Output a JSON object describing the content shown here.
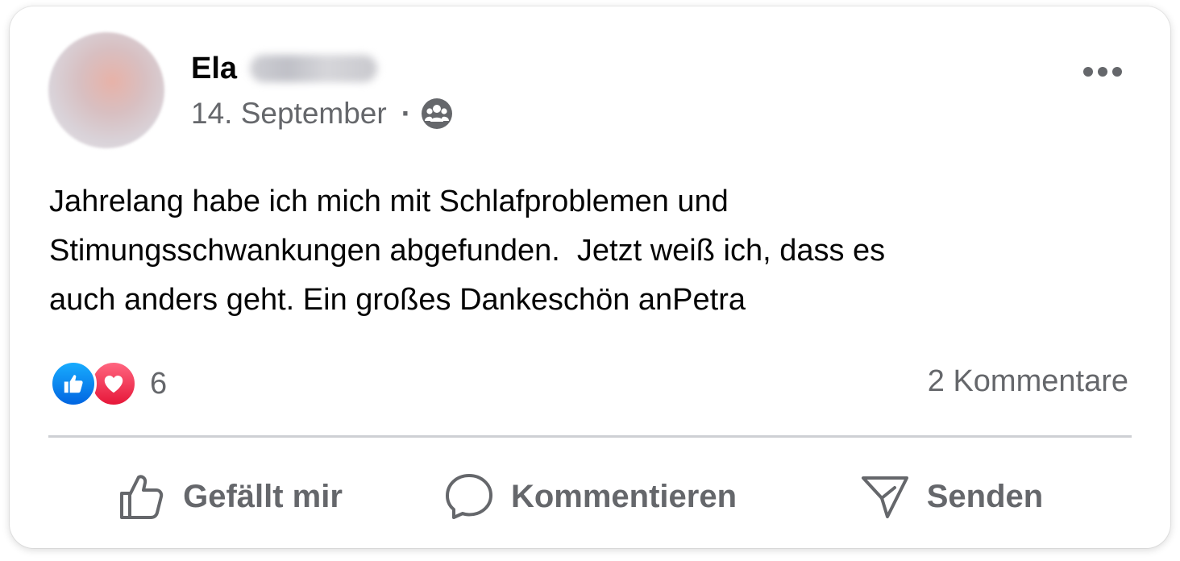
{
  "post": {
    "author": {
      "first_name": "Ela",
      "surname_redacted": true
    },
    "date": "14. September",
    "separator": "·",
    "audience_icon": "group-audience-icon",
    "more_icon": "more-options-icon",
    "text": "Jahrelang habe ich mich mit Schlafproblemen und\nStimungsschwankungen abgefunden.  Jetzt weiß ich, dass es\nauch anders geht. Ein großes Dankeschön anPetra"
  },
  "stats": {
    "reaction_icons": [
      "like-reaction-icon",
      "love-reaction-icon"
    ],
    "reaction_count": "6",
    "comments_label": "2 Kommentare"
  },
  "actions": {
    "like_label": "Gefällt mir",
    "comment_label": "Kommentieren",
    "share_label": "Senden"
  },
  "colors": {
    "text_primary": "#050505",
    "text_secondary": "#65676b",
    "like_blue": "#0866ff",
    "love_red": "#f0284a",
    "divider": "#ced0d4"
  }
}
